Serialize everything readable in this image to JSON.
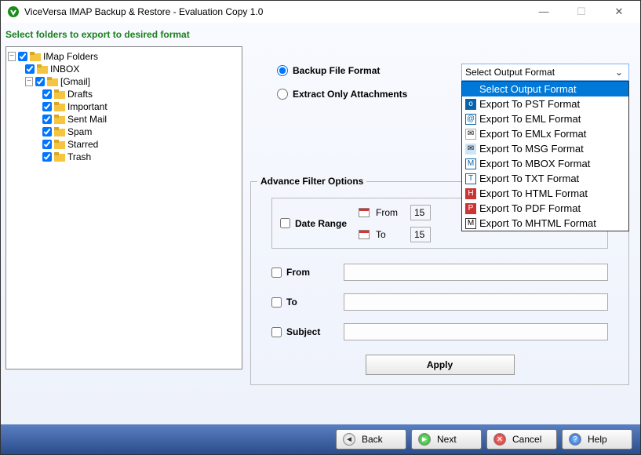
{
  "window": {
    "title": "ViceVersa IMAP Backup & Restore - Evaluation Copy 1.0",
    "subtitle": "Select folders to export to desired format"
  },
  "tree": {
    "root": {
      "label": "IMap Folders"
    },
    "items": [
      {
        "label": "INBOX",
        "indent": 1
      },
      {
        "label": "[Gmail]",
        "indent": 1,
        "expandable": true
      },
      {
        "label": "Drafts",
        "indent": 2
      },
      {
        "label": "Important",
        "indent": 2
      },
      {
        "label": "Sent Mail",
        "indent": 2
      },
      {
        "label": "Spam",
        "indent": 2
      },
      {
        "label": "Starred",
        "indent": 2
      },
      {
        "label": "Trash",
        "indent": 2
      }
    ]
  },
  "radios": {
    "backup": "Backup File Format",
    "extract": "Extract Only Attachments"
  },
  "dropdown": {
    "selected": "Select Output Format",
    "options": [
      {
        "label": "Select Output Format",
        "selected": true,
        "color": "#fff"
      },
      {
        "label": "Export To PST Format",
        "color": "#0a63a8"
      },
      {
        "label": "Export To EML Format",
        "color": "#0a63a8"
      },
      {
        "label": "Export To EMLx Format",
        "color": "#888"
      },
      {
        "label": "Export To MSG Format",
        "color": "#0a63a8"
      },
      {
        "label": "Export To MBOX Format",
        "color": "#0a63a8"
      },
      {
        "label": "Export To TXT Format",
        "color": "#0a63a8"
      },
      {
        "label": "Export To HTML Format",
        "color": "#c33"
      },
      {
        "label": "Export To PDF Format",
        "color": "#c33"
      },
      {
        "label": "Export To MHTML Format",
        "color": "#333"
      }
    ]
  },
  "filters": {
    "legend": "Advance Filter Options",
    "daterange_label": "Date Range",
    "from_label": "From",
    "to_label": "To",
    "day": "15",
    "from_filter": "From",
    "to_filter": "To",
    "subject_filter": "Subject",
    "apply": "Apply"
  },
  "nav": {
    "back": "Back",
    "next": "Next",
    "cancel": "Cancel",
    "help": "Help"
  }
}
